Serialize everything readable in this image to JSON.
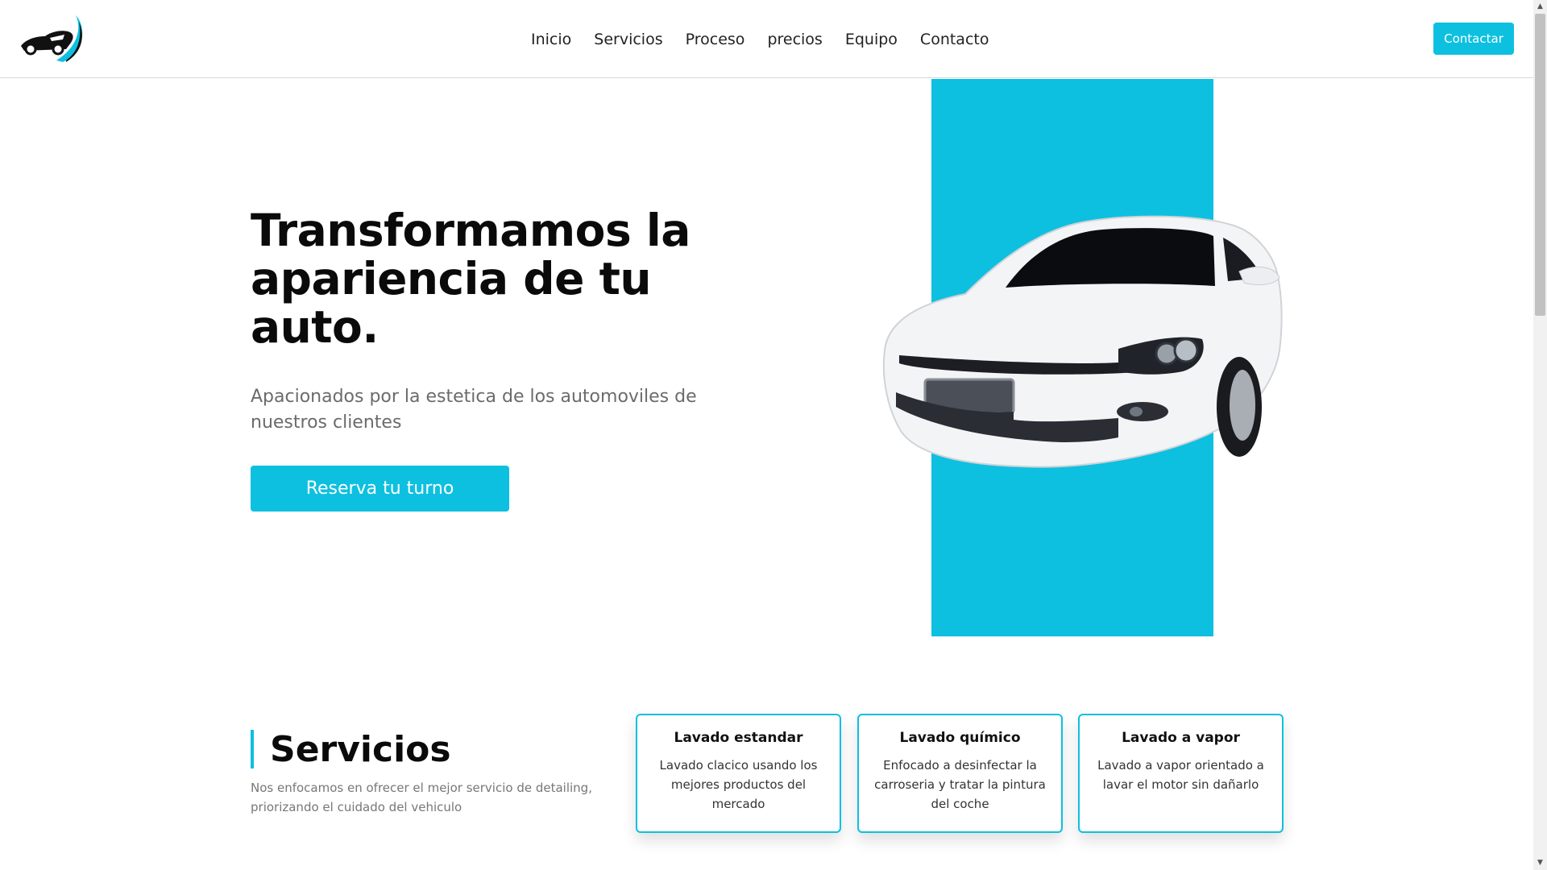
{
  "header": {
    "logo_icon": "car-swoosh-logo",
    "nav": [
      "Inicio",
      "Servicios",
      "Proceso",
      "precios",
      "Equipo",
      "Contacto"
    ],
    "contact_button": "Contactar"
  },
  "hero": {
    "title": "Transformamos la apariencia de tu auto.",
    "subtitle": "Apacionados por la estetica de los automoviles de nuestros clientes",
    "cta": "Reserva tu turno",
    "image": "white-car-front-view"
  },
  "services": {
    "title": "Servicios",
    "description": "Nos enfocamos en ofrecer el mejor servicio de detailing, priorizando el cuidado del vehiculo",
    "cards": [
      {
        "title": "Lavado estandar",
        "text": "Lavado clacico usando los mejores productos del mercado"
      },
      {
        "title": "Lavado químico",
        "text": "Enfocado a desinfectar la carroseria y tratar la pintura del coche"
      },
      {
        "title": "Lavado a vapor",
        "text": "Lavado a vapor orientado a lavar el motor sin dañarlo"
      }
    ]
  },
  "colors": {
    "accent": "#0dc0e0",
    "text_dark": "#0a0a0a",
    "text_muted": "#6b6b6b"
  }
}
